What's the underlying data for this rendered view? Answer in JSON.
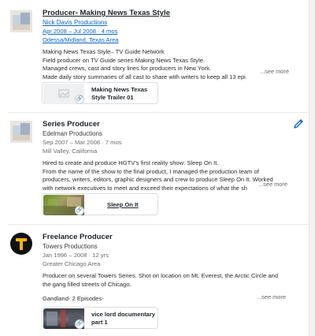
{
  "entries": [
    {
      "title": "Producer- Making News Texas Style",
      "company": "Nick Davis Productions",
      "dates": "Apr 2008 – Jul 2008 · 4 mos",
      "location": "Odessa/Midland, Texas Area",
      "description": [
        "Making News Texas Style– TV Guide Network",
        "Field producer on TV Guide series Making News Texas Style.",
        "Managed crews, cast and story lines for producers in New York.",
        "Made daily story summaries of all cast to share with writers to keep all 13 epi"
      ],
      "see_more": "...see more",
      "media": {
        "title_line1": "Making News Texas",
        "title_line2": "Style Trailer 01"
      }
    },
    {
      "title": "Series Producer",
      "company": "Edelman Productions",
      "dates": "Sep 2007 – Mar 2008 · 7 mos",
      "location": "Mill Valley, California",
      "description": [
        "Hired to create and produce HGTV's first reality show: Sleep On It.",
        "From the name of the show to the final product, I managed the production team of",
        "producers, writers, editors, graphic designers and crew to produce Sleep On It. Worked",
        "with network executives to meet and exceed their expectations of what the sh"
      ],
      "see_more": "...see more",
      "media": {
        "title_line1": "Sleep On It",
        "title_line2": ""
      }
    },
    {
      "title": "Freelance Producer",
      "company": "Towers Productions",
      "dates": "Jan 1996 – 2008 · 12 yrs",
      "location": "Greater Chicago Area",
      "description": [
        "Producer on several Towers Series. Shot on location on Mt. Everest, the Arctic Circle and",
        "the gang filled streets of Chicago."
      ],
      "extra_line": "Gandland- 2 Episodes-",
      "see_more": "...see more",
      "media": {
        "title_line1": "vice lord documentary",
        "title_line2": "part 1"
      }
    }
  ],
  "icons": {
    "edit": "pencil-icon",
    "link": "link-icon",
    "logo3": "towers-t-logo"
  },
  "colors": {
    "link": "#0a66c2",
    "accent_logo": "#f2b705"
  }
}
